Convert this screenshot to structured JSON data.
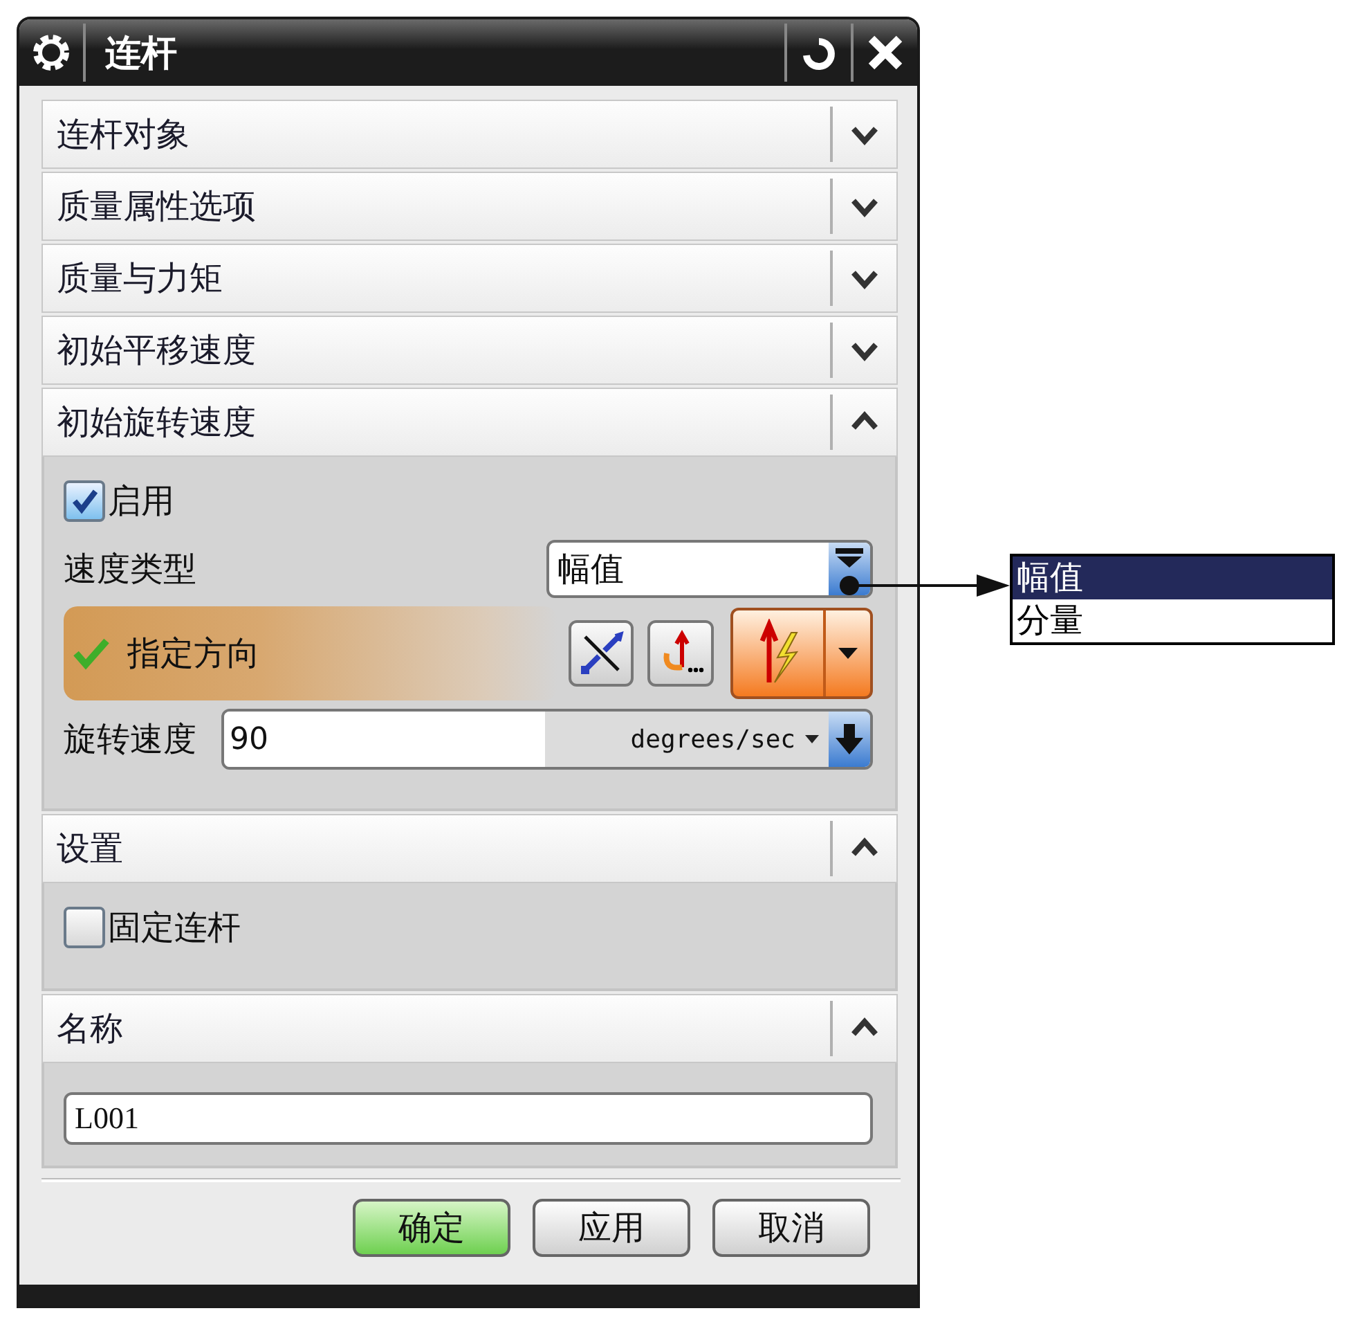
{
  "window": {
    "title": "连杆"
  },
  "sections": [
    {
      "title": "连杆对象",
      "expanded": false
    },
    {
      "title": "质量属性选项",
      "expanded": false
    },
    {
      "title": "质量与力矩",
      "expanded": false
    },
    {
      "title": "初始平移速度",
      "expanded": false
    },
    {
      "title": "初始旋转速度",
      "expanded": true,
      "rows": [
        {
          "kind": "checkbox",
          "label": "启用",
          "checked": true
        },
        {
          "kind": "dropdown",
          "label": "速度类型",
          "value": "幅值"
        },
        {
          "kind": "selector",
          "label": "指定方向",
          "complete": true
        },
        {
          "kind": "unit_input",
          "label": "旋转速度",
          "value": "90",
          "unit": "degrees/sec"
        }
      ]
    },
    {
      "title": "设置",
      "expanded": true,
      "rows": [
        {
          "kind": "checkbox",
          "label": "固定连杆",
          "checked": false
        }
      ]
    },
    {
      "title": "名称",
      "expanded": true,
      "rows": [
        {
          "kind": "text_input",
          "value": "L001"
        }
      ]
    }
  ],
  "dropdown_list": {
    "options": [
      {
        "label": "幅值",
        "selected": true
      },
      {
        "label": "分量",
        "selected": false
      }
    ]
  },
  "buttons": [
    {
      "label": "确定",
      "default": true
    },
    {
      "label": "应用",
      "default": false
    },
    {
      "label": "取消",
      "default": false
    }
  ]
}
